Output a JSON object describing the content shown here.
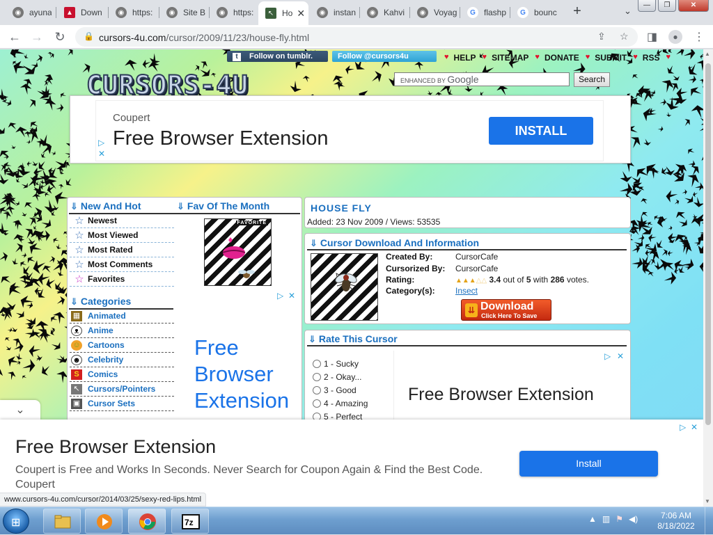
{
  "browser": {
    "tabs": [
      {
        "label": "ayuna",
        "favicon": "globe-icon"
      },
      {
        "label": "Down",
        "favicon": "red-pdf-icon"
      },
      {
        "label": "https:",
        "favicon": "globe-icon"
      },
      {
        "label": "Site B",
        "favicon": "globe-icon"
      },
      {
        "label": "https:",
        "favicon": "globe-icon"
      },
      {
        "label": "Ho",
        "favicon": "cursor-site-icon",
        "active": true
      },
      {
        "label": "instan",
        "favicon": "globe-icon"
      },
      {
        "label": "Kahvi",
        "favicon": "globe-icon"
      },
      {
        "label": "Voyag",
        "favicon": "globe-icon"
      },
      {
        "label": "flashp",
        "favicon": "google-icon"
      },
      {
        "label": "bounc",
        "favicon": "google-icon"
      }
    ],
    "new_tab_symbol": "+",
    "tab_close_symbol": "✕",
    "url_domain": "cursors-4u.com",
    "url_path": "/cursor/2009/11/23/house-fly.html",
    "status_url": "www.cursors-4u.com/cursor/2014/03/25/sexy-red-lips.html"
  },
  "site": {
    "logo": "CURSORS-4U",
    "tumblr_label": "Follow on tumblr.",
    "twitter_label": "Follow @cursors4u",
    "nav": [
      "HELP",
      "SITEMAP",
      "DONATE",
      "SUBMIT",
      "RSS"
    ],
    "search_placeholder": "ENHANCED BY",
    "search_brand": "Google",
    "search_button": "Search"
  },
  "ad_top": {
    "brand": "Coupert",
    "title": "Free Browser Extension",
    "button": "INSTALL"
  },
  "left": {
    "new_and_hot_heading": "New And Hot",
    "fav_heading": "Fav Of The Month",
    "fav_badge": "FAVORITE",
    "menu": [
      "Newest",
      "Most Viewed",
      "Most Rated",
      "Most Comments",
      "Favorites"
    ],
    "categories_heading": "Categories",
    "categories": [
      "Animated",
      "Anime",
      "Cartoons",
      "Celebrity",
      "Comics",
      "Cursors/Pointers",
      "Cursor Sets"
    ],
    "ad_text": [
      "Free",
      "Browser",
      "Extension"
    ]
  },
  "cursor": {
    "title": "HOUSE FLY",
    "added": "Added: 23 Nov 2009 / Views: 53535",
    "section_heading": "Cursor Download And Information",
    "created_by_label": "Created By:",
    "created_by": "CursorCafe",
    "cursorized_by_label": "Cursorized By:",
    "cursorized_by": "CursorCafe",
    "rating_label": "Rating:",
    "rating_value": "3.4",
    "rating_max": "5",
    "rating_votes": "286",
    "rating_out_of": "out of",
    "rating_with": "with",
    "rating_votes_word": "votes.",
    "category_label": "Category(s):",
    "category": "Insect",
    "download_label": "Download",
    "download_sub": "Click Here To Save"
  },
  "rate": {
    "heading": "Rate This Cursor",
    "options": [
      "1 - Sucky",
      "2 - Okay...",
      "3 - Good",
      "4 - Amazing",
      "5 - Perfect"
    ],
    "ad_text": "Free Browser Extension"
  },
  "ad_bottom": {
    "title": "Free Browser Extension",
    "desc": "Coupert is Free and Works In Seconds. Never Search for Coupon Again & Find the Best Code. Coupert",
    "button": "Install"
  },
  "taskbar": {
    "time": "7:06 AM",
    "date": "8/18/2022"
  },
  "colors": {
    "accent_blue": "#1a73e8",
    "site_blue": "#1a6fbf",
    "heart_red": "#e0142d",
    "download_red": "#c42a10"
  }
}
